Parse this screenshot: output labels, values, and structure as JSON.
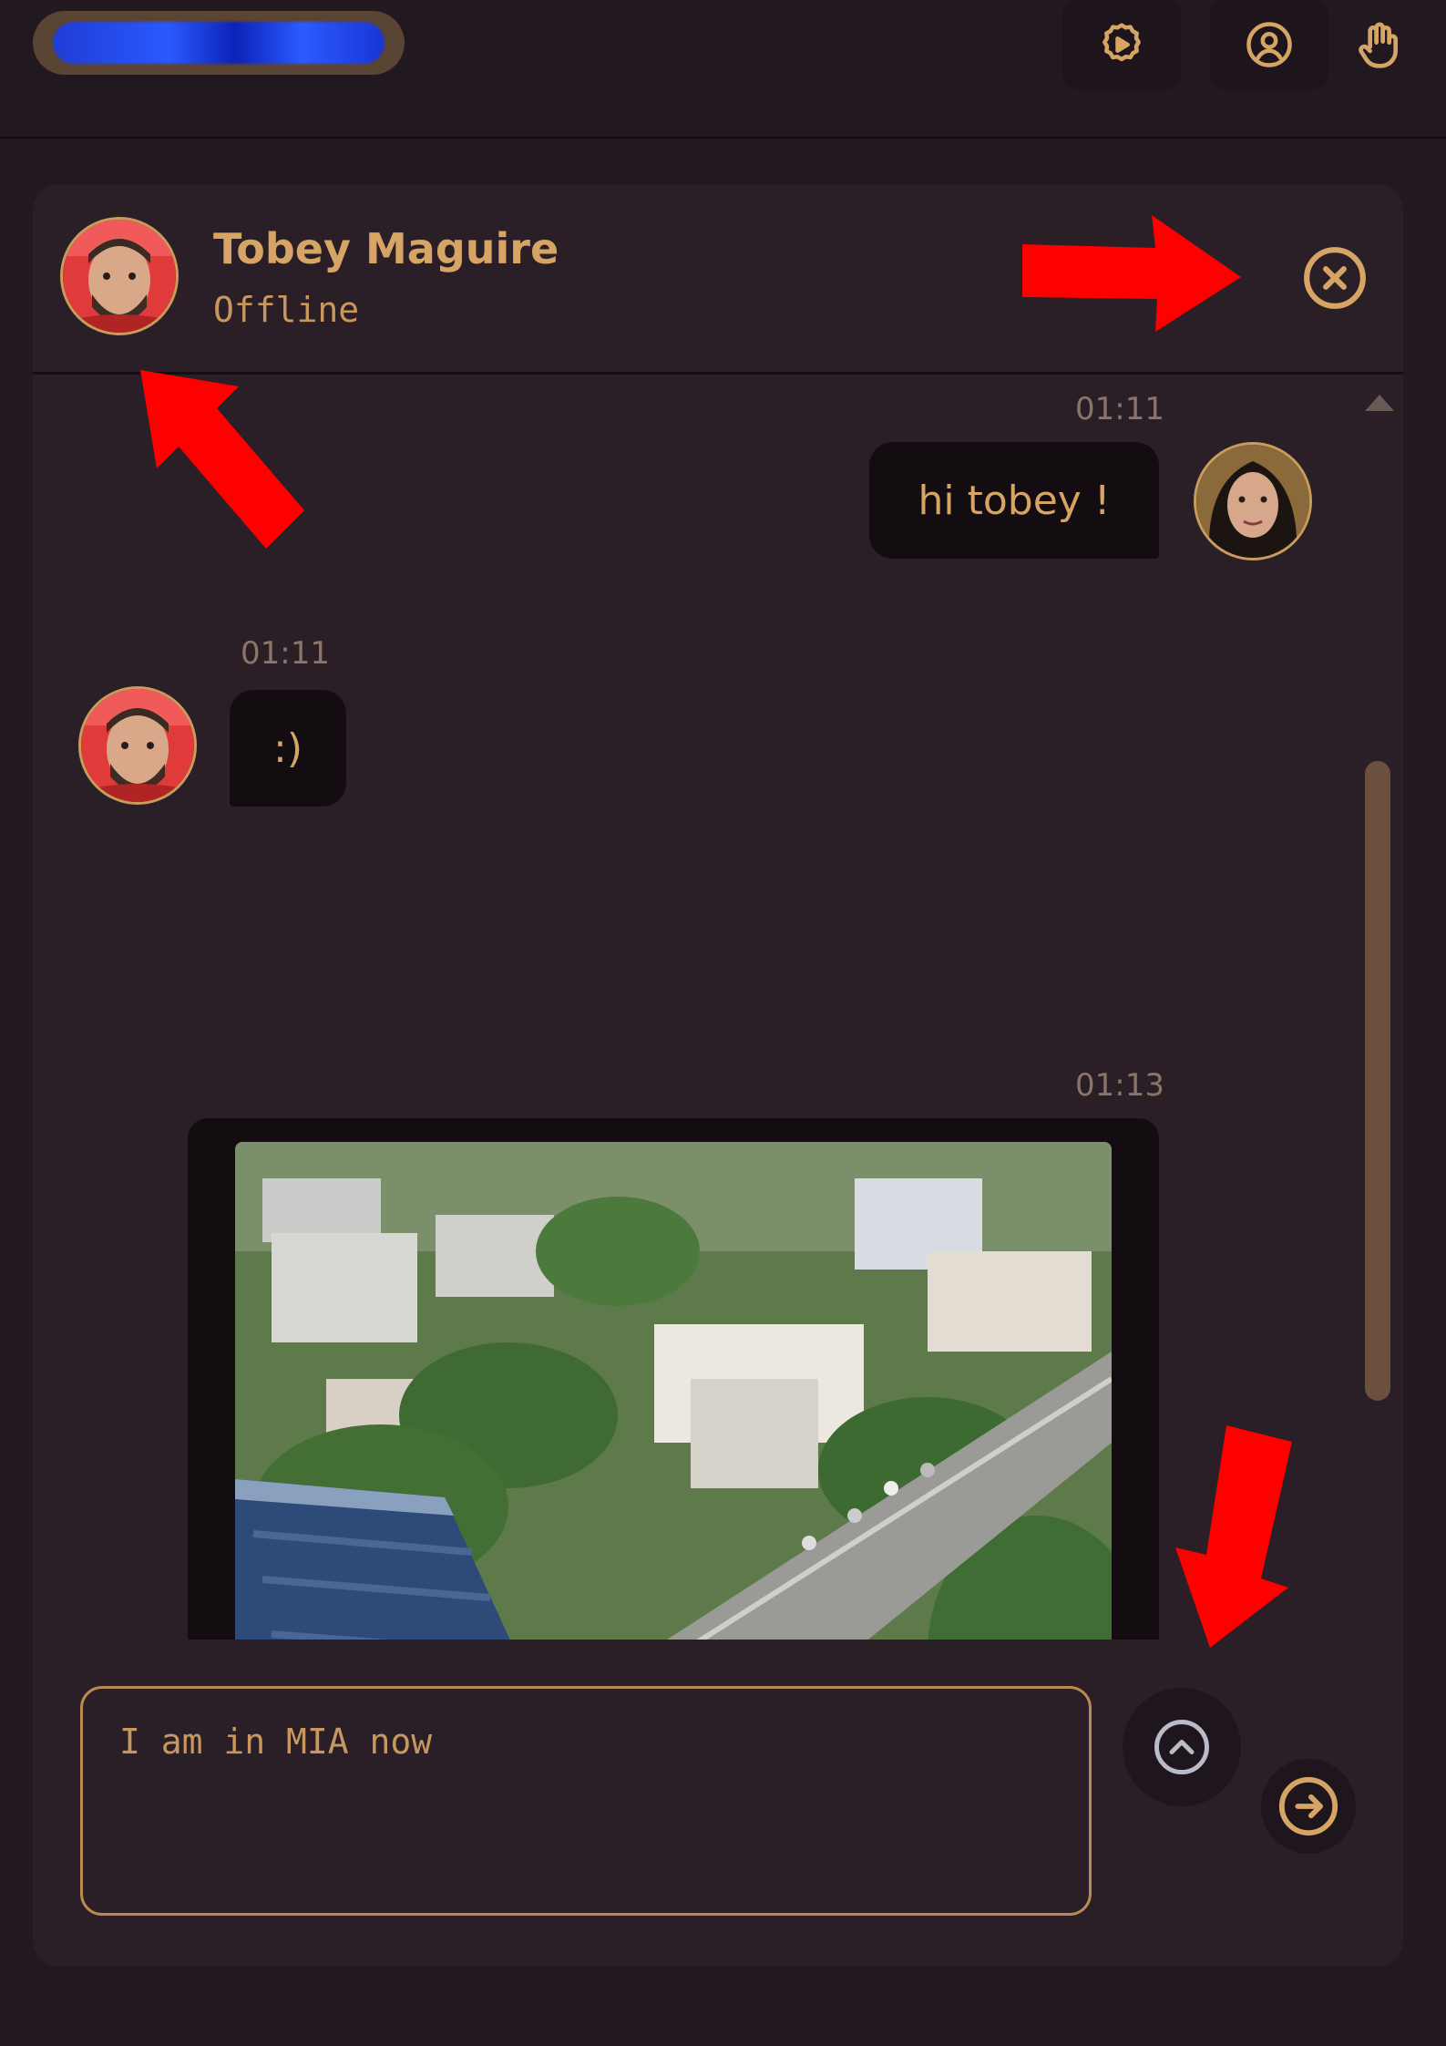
{
  "topbar": {
    "logo_icon": "blurred-logo",
    "settings_icon": "gear-icon",
    "profile_icon": "user-circle-icon",
    "wave_icon": "hand-icon"
  },
  "chat": {
    "contact_name": "Tobey Maguire",
    "contact_status": "Offline",
    "close_icon": "close-circle-icon"
  },
  "messages": [
    {
      "time": "01:11",
      "text": "hi tobey !",
      "from": "self"
    },
    {
      "time": "01:11",
      "text": ":)",
      "from": "contact"
    },
    {
      "time": "01:13",
      "type": "image",
      "from": "self"
    }
  ],
  "composer": {
    "value": "I am in MIA now",
    "expand_icon": "chevron-up-circle-icon",
    "send_icon": "arrow-right-circle-icon"
  },
  "colors": {
    "accent": "#d6a465",
    "background": "#221820",
    "panel": "#2a1e27",
    "bubble": "#130d12",
    "annotation_arrow": "#ff0000"
  }
}
